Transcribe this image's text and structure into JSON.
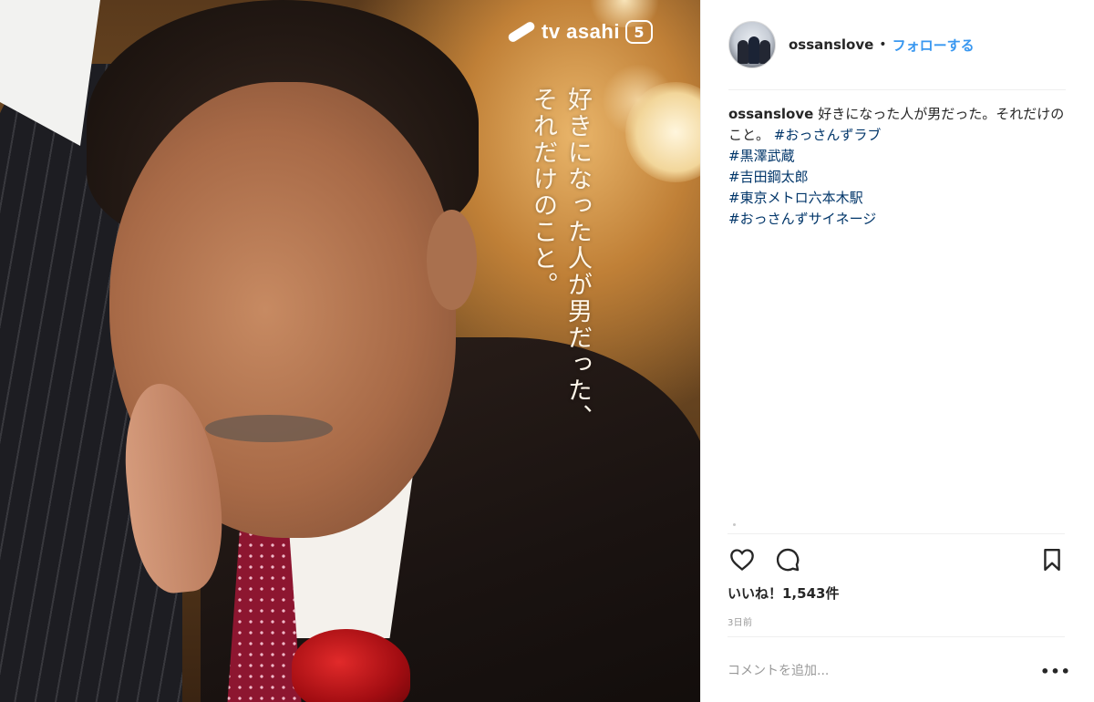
{
  "photo": {
    "logo_text": "tv asahi",
    "channel_badge": "5",
    "poster_lines": [
      "好きになった人が男だった、",
      "それだけのこと。"
    ]
  },
  "post": {
    "username": "ossanslove",
    "separator": "•",
    "follow_label": "フォローする",
    "caption_text": "好きになった人が男だった。それだけのこと。",
    "hashtags": [
      "#おっさんずラブ",
      "#黒澤武蔵",
      "#吉田鋼太郎",
      "#東京メトロ六本木駅",
      "#おっさんずサイネージ"
    ],
    "likes": "いいね！1,543件",
    "time": "3日前",
    "comment_placeholder": "コメントを追加...",
    "more_label": "•••"
  },
  "icons": {
    "heart": "heart-icon",
    "comment": "comment-icon",
    "bookmark": "bookmark-icon",
    "more": "more-options-icon"
  },
  "colors": {
    "link": "#3897f0",
    "hashtag": "#003569",
    "text": "#262626",
    "muted": "#999999"
  }
}
